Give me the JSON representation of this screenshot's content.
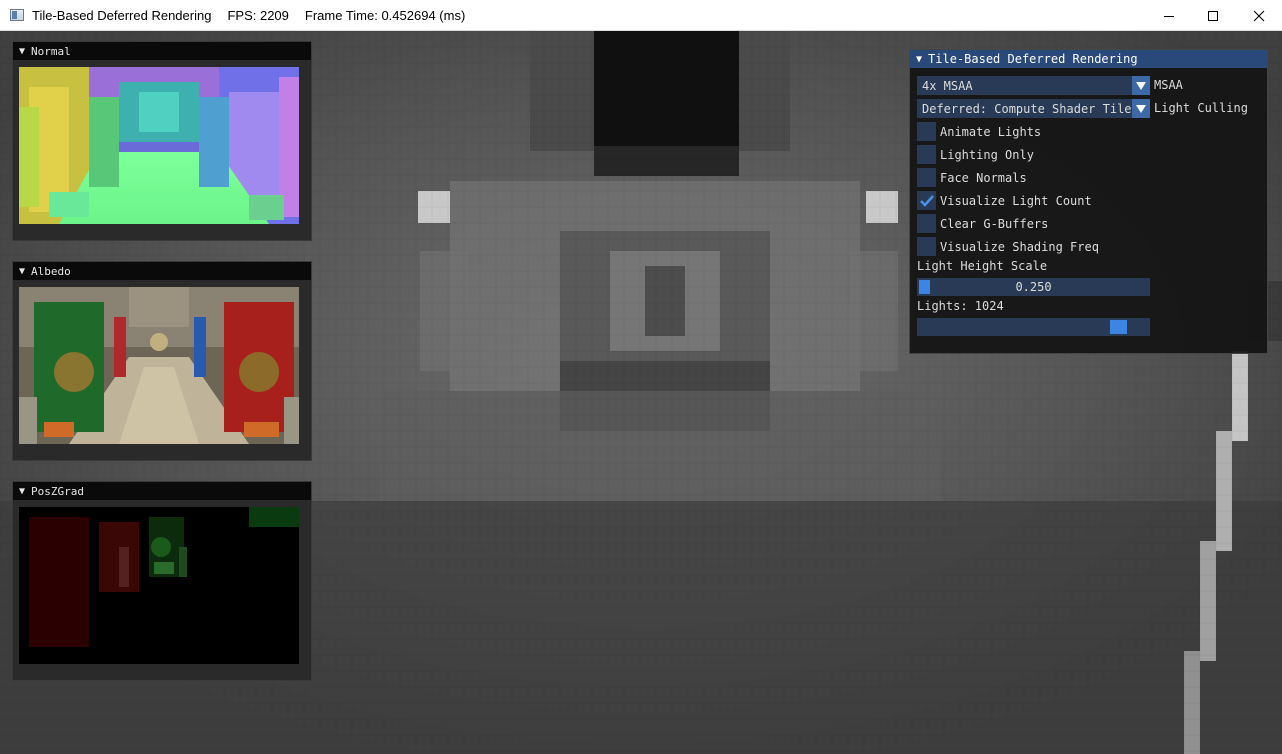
{
  "titlebar": {
    "app_title": "Tile-Based Deferred Rendering",
    "fps": "FPS: 2209",
    "frame_time": "Frame Time: 0.452694 (ms)"
  },
  "gbuffer_windows": [
    {
      "title": "Normal"
    },
    {
      "title": "Albedo"
    },
    {
      "title": "PosZGrad"
    }
  ],
  "panel": {
    "title": "Tile-Based Deferred Rendering",
    "msaa_combo": {
      "value": "4x MSAA",
      "label": "MSAA"
    },
    "culling_combo": {
      "value": "Deferred: Compute Shader Tile",
      "label": "Light Culling"
    },
    "checkboxes": [
      {
        "label": "Animate Lights",
        "checked": false
      },
      {
        "label": "Lighting Only",
        "checked": false
      },
      {
        "label": "Face Normals",
        "checked": false
      },
      {
        "label": "Visualize Light Count",
        "checked": true
      },
      {
        "label": "Clear G-Buffers",
        "checked": false
      },
      {
        "label": "Visualize Shading Freq",
        "checked": false
      }
    ],
    "height_scale": {
      "label": "Light Height Scale",
      "value": "0.250",
      "fraction": 0.0
    },
    "lights": {
      "label": "Lights: 1024",
      "fraction": 0.9
    }
  },
  "colors": {
    "panel_title_bg": "#29497a",
    "frame_bg": "#283a55",
    "accent": "#3d85e0",
    "check": "#4a90e2"
  }
}
